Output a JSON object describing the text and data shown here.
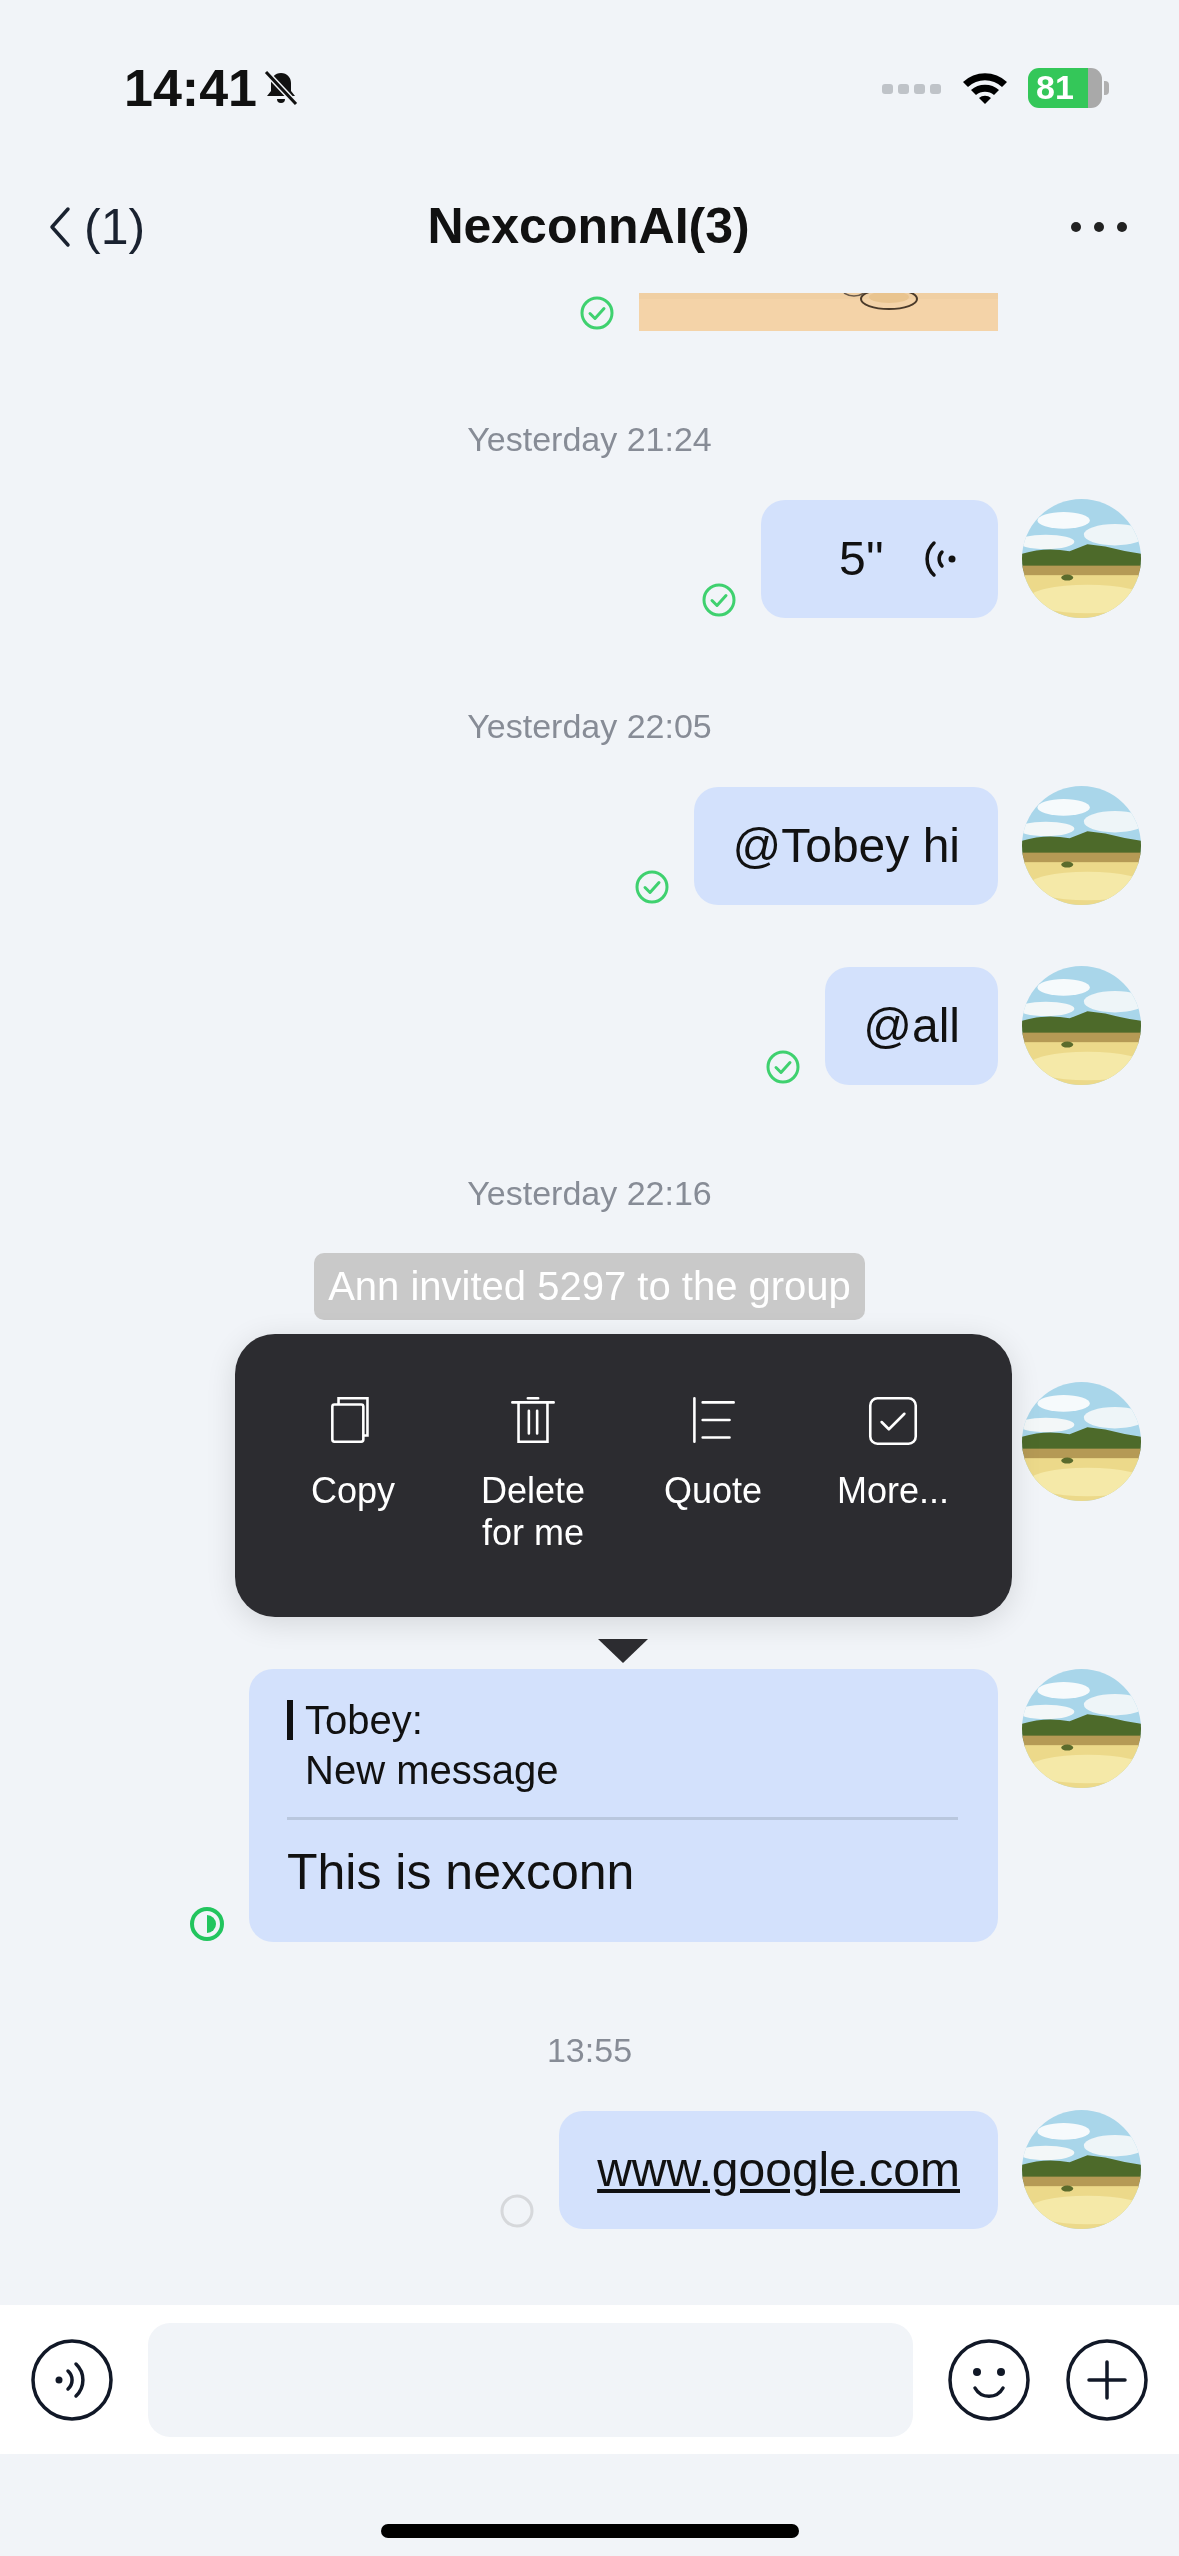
{
  "status_bar": {
    "time": "14:41",
    "battery": "81"
  },
  "nav": {
    "back": "(1)",
    "title": "NexconnAI(3)"
  },
  "messages": [
    {
      "status": {
        "kind": "sent"
      }
    },
    {
      "kind": "timestamp",
      "text": "Yesterday 21:24"
    },
    {
      "kind": "voice",
      "text": "5''",
      "status": {
        "kind": "sent"
      }
    },
    {
      "kind": "timestamp",
      "text": "Yesterday 22:05"
    },
    {
      "kind": "text",
      "text": "@Tobey hi",
      "status": {
        "kind": "sent"
      }
    },
    {
      "kind": "text",
      "text": "@all",
      "status": {
        "kind": "sent"
      }
    },
    {
      "kind": "timestamp",
      "text": "Yesterday 22:16"
    },
    {
      "kind": "notice",
      "text": "Ann invited 5297 to the group"
    },
    {
      "kind": "covered"
    },
    {
      "kind": "quote",
      "quote_author": "Tobey:",
      "quote_text": "New message",
      "text": "This is nexconn",
      "status": {
        "kind": "sending"
      }
    },
    {
      "kind": "timestamp",
      "text": "13:55"
    },
    {
      "kind": "link",
      "text": "www.google.com",
      "status": {
        "kind": "pending"
      }
    }
  ],
  "context_menu": {
    "items": [
      {
        "kind": "copy",
        "label": "Copy"
      },
      {
        "kind": "delete",
        "label": "Delete for me"
      },
      {
        "kind": "quote",
        "label": "Quote"
      },
      {
        "kind": "select",
        "label": "More..."
      }
    ]
  }
}
